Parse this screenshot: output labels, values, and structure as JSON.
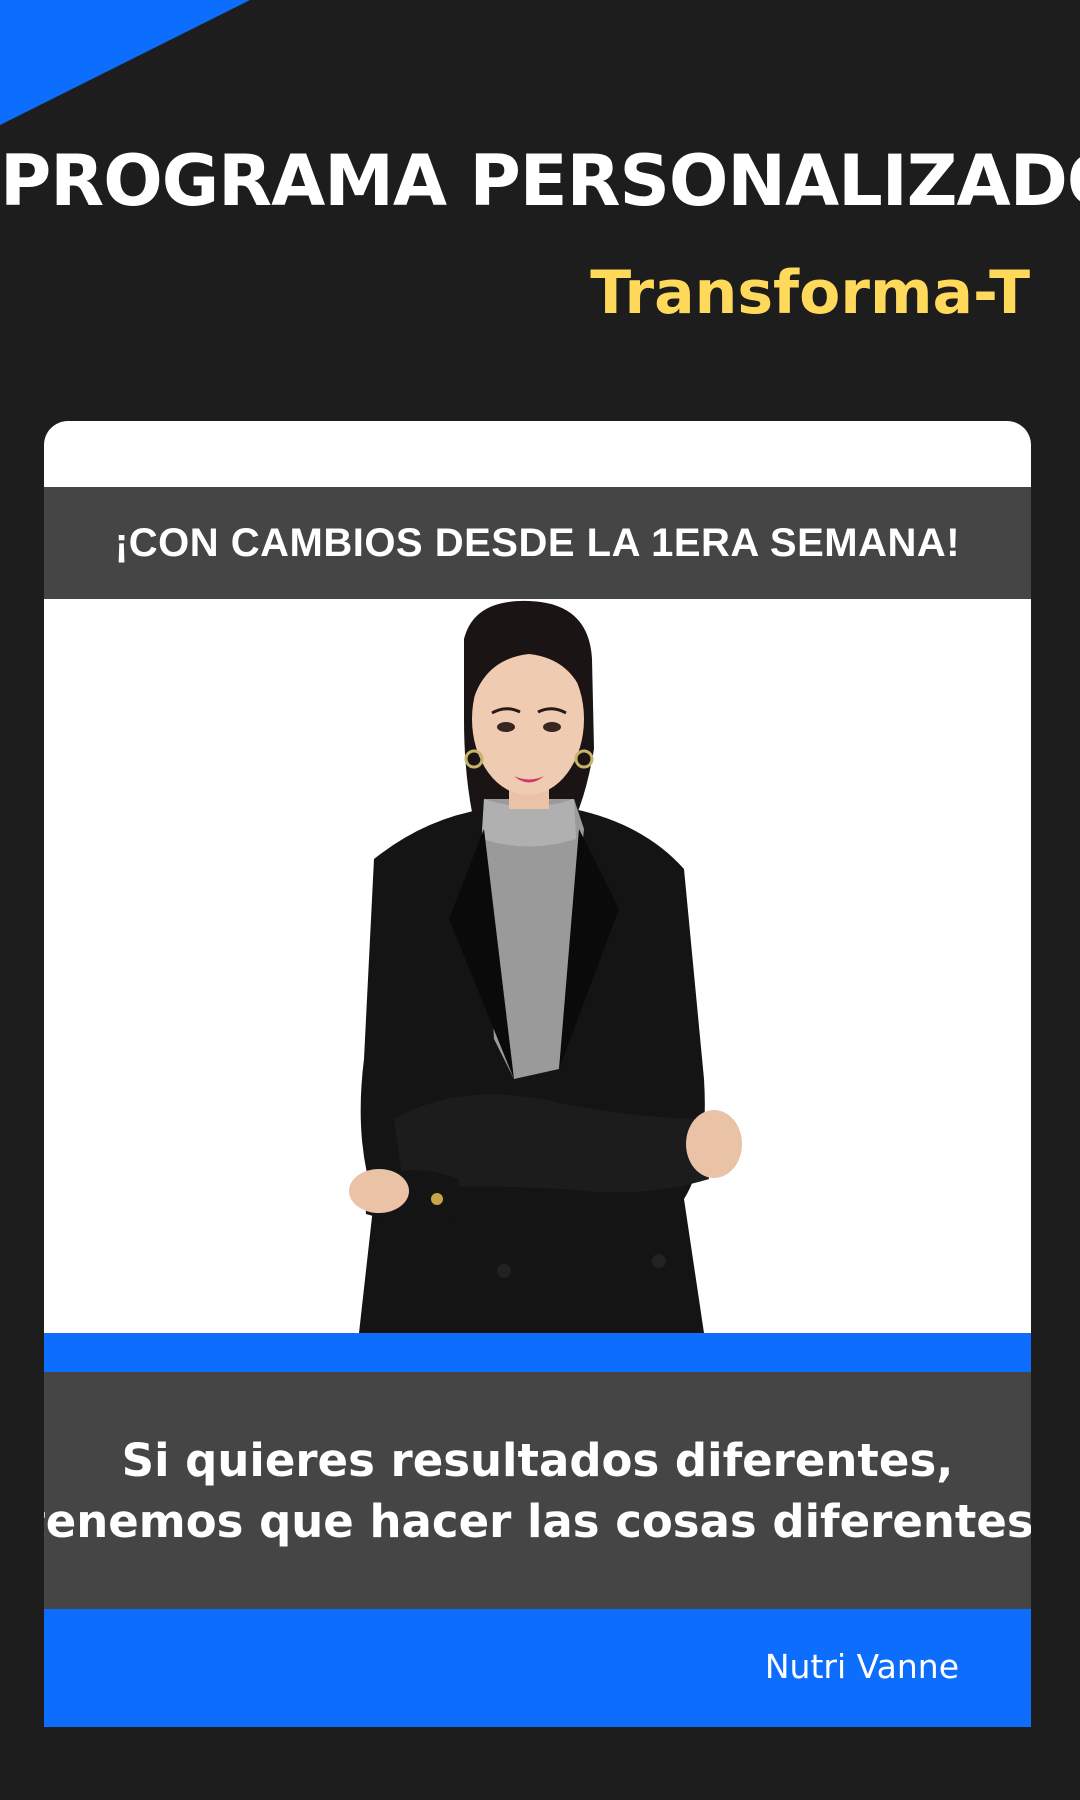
{
  "header": {
    "title": "PROGRAMA PERSONALIZADO",
    "subtitle": "Transforma-T"
  },
  "card": {
    "tagline": "¡CON CAMBIOS DESDE LA 1ERA SEMANA!",
    "quote_line_1": "Si quieres resultados diferentes,",
    "quote_line_2": "tenemos que hacer las cosas diferentes.",
    "brand": "Nutri Vanne"
  },
  "colors": {
    "background": "#1e1d1d",
    "accent_blue": "#0d6efd",
    "accent_yellow": "#ffd95a",
    "band_gray": "#454545"
  }
}
